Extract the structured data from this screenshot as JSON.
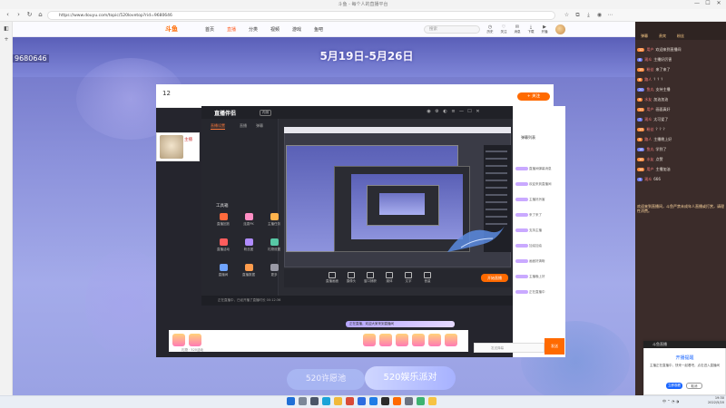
{
  "browser": {
    "window_title": "斗鱼 - 每个人的直播平台",
    "url": "https://www.douyu.com/topic/520lovetop?rid=9680646",
    "window_controls": [
      "—",
      "☐",
      "✕"
    ]
  },
  "site": {
    "logo": "斗鱼",
    "nav": [
      "首页",
      "直播",
      "分类",
      "视频",
      "游戏",
      "鱼吧"
    ],
    "active_nav": "直播",
    "search_placeholder": "搜索",
    "header_icons": [
      "历史",
      "关注",
      "消息",
      "下载",
      "开播"
    ],
    "banner_date": "5月19日-5月26日",
    "room_number": "9680646"
  },
  "stream": {
    "room_level": "12",
    "follow_label": "+ 关注",
    "hero_card_name": "主播"
  },
  "live_tool": {
    "logo": "直播伴侣",
    "badge": "内测",
    "tabs": [
      "直播设置",
      "直播",
      "弹幕"
    ],
    "toolbox_title": "工具箱",
    "toolbox_items": [
      {
        "label": "直播回放",
        "color": "#ff6a3c"
      },
      {
        "label": "连麦PK",
        "color": "#ff8ec4"
      },
      {
        "label": "主播任务",
        "color": "#ffb34d"
      },
      {
        "label": "直播活动",
        "color": "#ff5d5d"
      },
      {
        "label": "粉丝团",
        "color": "#b08cff"
      },
      {
        "label": "礼物设置",
        "color": "#57c7a5"
      },
      {
        "label": "直播间",
        "color": "#6fa4ff"
      },
      {
        "label": "直播数据",
        "color": "#ff9d4d"
      },
      {
        "label": "更多",
        "color": "#9a9aa6"
      }
    ],
    "bottom_buttons": [
      "直播画面",
      "摄像头",
      "窗口捕获",
      "媒体",
      "文字",
      "音量"
    ],
    "go_live_label": "开始直播",
    "status_text": "正在直播中，已经开播了直播时长 00:12:36"
  },
  "stream_chat": {
    "title": "弹幕列表",
    "lines": [
      "直播间弹幕消息",
      "欢迎来到直播间",
      "主播好厉害",
      "来了来了",
      "支持主播",
      "加油加油",
      "画面好清晰",
      "主播晚上好",
      "正在直播中"
    ],
    "input_placeholder": "发送弹幕",
    "send_label": "发送"
  },
  "live_overlay_text": "正在直播，欢迎大家来到直播间",
  "gift_label": "礼物 · 520活动",
  "promo": {
    "button1": "520许愿池",
    "button2": "520娱乐派对"
  },
  "right_panel": {
    "tabs": [
      "弹幕",
      "贵宾",
      "粉丝"
    ],
    "messages": [
      {
        "tag": "12",
        "name": "用户",
        "text": "欢迎来到直播间"
      },
      {
        "tag": "8",
        "name": "观众",
        "text": "主播好厉害"
      },
      {
        "tag": "15",
        "name": "粉丝",
        "text": "来了来了"
      },
      {
        "tag": "6",
        "name": "路人",
        "text": "？？？"
      },
      {
        "tag": "20",
        "name": "鱼丸",
        "text": "支持主播"
      },
      {
        "tag": "9",
        "name": "水友",
        "text": "加油加油"
      },
      {
        "tag": "11",
        "name": "用户",
        "text": "画面真好"
      },
      {
        "tag": "7",
        "name": "观众",
        "text": "太可爱了"
      },
      {
        "tag": "13",
        "name": "粉丝",
        "text": "？？？"
      },
      {
        "tag": "5",
        "name": "路人",
        "text": "主播晚上好"
      },
      {
        "tag": "18",
        "name": "鱼丸",
        "text": "学到了"
      },
      {
        "tag": "10",
        "name": "水友",
        "text": "点赞"
      },
      {
        "tag": "14",
        "name": "用户",
        "text": "主播加油"
      },
      {
        "tag": "3",
        "name": "观众",
        "text": "666"
      }
    ],
    "notice": "欢迎来到直播间，斗鱼严禁未成年人直播或打赏，请理性消费。"
  },
  "popup": {
    "header": "斗鱼直播",
    "title": "开播提醒",
    "body": "主播正在直播中，快来一起看吧，点击进入直播间",
    "btn_primary": "立即观看",
    "btn_secondary": "取消"
  },
  "taskbar": {
    "time": "19:30",
    "date": "2022/5/20",
    "tray": "中 ⌃ ◔ ◑",
    "apps": [
      {
        "name": "start",
        "color": "#1f6fd6"
      },
      {
        "name": "search",
        "color": "#7c8798"
      },
      {
        "name": "taskview",
        "color": "#4a5568"
      },
      {
        "name": "edge",
        "color": "#1aa4d8"
      },
      {
        "name": "folder",
        "color": "#f1b93a"
      },
      {
        "name": "chrome",
        "color": "#d94a38"
      },
      {
        "name": "store",
        "color": "#2d6cdf"
      },
      {
        "name": "mail",
        "color": "#1f7de6"
      },
      {
        "name": "media",
        "color": "#2b2b2b"
      },
      {
        "name": "live",
        "color": "#ff6a00"
      },
      {
        "name": "settings",
        "color": "#6b7280"
      },
      {
        "name": "chat",
        "color": "#3cb371"
      },
      {
        "name": "notes",
        "color": "#f6c343"
      }
    ]
  }
}
